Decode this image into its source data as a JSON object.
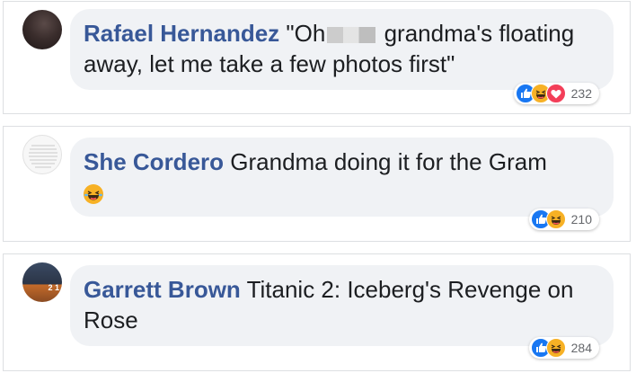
{
  "comments": [
    {
      "author": "Rafael Hernandez",
      "text_before": "\"Oh",
      "text_after": "grandma's floating away, let me take a few photos first\"",
      "reaction_count": "232",
      "reactions": [
        "like-icon",
        "haha-icon",
        "love-icon"
      ]
    },
    {
      "author": "She Cordero",
      "text": "Grandma doing it for the Gram",
      "emoji": "laughing-emoji-icon",
      "reaction_count": "210",
      "reactions": [
        "like-icon",
        "haha-icon"
      ]
    },
    {
      "author": "Garrett Brown",
      "text": "Titanic 2: Iceberg's Revenge on Rose",
      "reaction_count": "284",
      "reactions": [
        "like-icon",
        "haha-icon"
      ],
      "avatar_badge": "2 1"
    }
  ],
  "colors": {
    "author": "#385898",
    "bubble": "#f0f2f5",
    "like": "#1877f2",
    "haha": "#f7b125",
    "love": "#f33e58"
  }
}
